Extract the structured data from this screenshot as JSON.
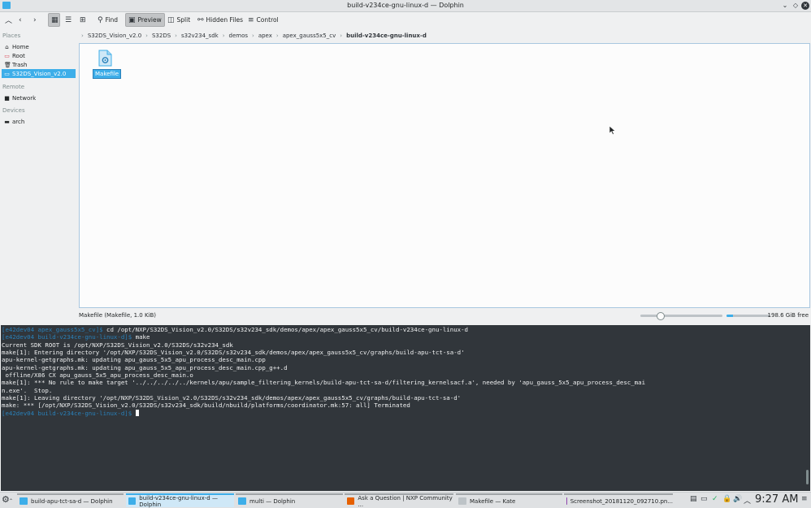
{
  "window": {
    "title": "build-v234ce-gnu-linux-d — Dolphin"
  },
  "toolbar": {
    "find": "Find",
    "preview": "Preview",
    "split": "Split",
    "hidden_files": "Hidden Files",
    "control": "Control"
  },
  "places": {
    "places_title": "Places",
    "items": [
      "Home",
      "Root",
      "Trash",
      "S32DS_Vision_v2.0"
    ],
    "remote_title": "Remote",
    "remote_items": [
      "Network"
    ],
    "devices_title": "Devices",
    "device_items": [
      "arch"
    ]
  },
  "breadcrumb": [
    "S32DS_Vision_v2.0",
    "S32DS",
    "s32v234_sdk",
    "demos",
    "apex",
    "apex_gauss5x5_cv",
    "build-v234ce-gnu-linux-d"
  ],
  "files": [
    {
      "name": "Makefile"
    }
  ],
  "statusbar": {
    "text": "Makefile (Makefile, 1.0 KiB)",
    "free": "198.6 GiB free",
    "space_used_fraction": 0.15,
    "zoom_fraction": 0.22
  },
  "terminal": {
    "lines": [
      {
        "prompt": "[e42dev04 apex_gauss5x5_cv]$",
        "text": " cd /opt/NXP/S32DS_Vision_v2.0/S32DS/s32v234_sdk/demos/apex/apex_gauss5x5_cv/build-v234ce-gnu-linux-d"
      },
      {
        "prompt": "[e42dev04 build-v234ce-gnu-linux-d]$",
        "text": " make"
      },
      {
        "prompt": "",
        "text": "Current SDK ROOT is /opt/NXP/S32DS_Vision_v2.0/S32DS/s32v234_sdk"
      },
      {
        "prompt": "",
        "text": "make[1]: Entering directory '/opt/NXP/S32DS_Vision_v2.0/S32DS/s32v234_sdk/demos/apex/apex_gauss5x5_cv/graphs/build-apu-tct-sa-d'"
      },
      {
        "prompt": "",
        "text": "apu-kernel-getgraphs.mk: updating apu_gauss_5x5_apu_process_desc_main.cpp"
      },
      {
        "prompt": "",
        "text": "apu-kernel-getgraphs.mk: updating apu_gauss_5x5_apu_process_desc_main.cpp_g++.d"
      },
      {
        "prompt": "",
        "text": " offline/X86 CX apu_gauss_5x5_apu_process_desc_main.o"
      },
      {
        "prompt": "",
        "text": "make[1]: *** No rule to make target '../../../../../kernels/apu/sample_filtering_kernels/build-apu-tct-sa-d/filtering_kernelsacf.a', needed by 'apu_gauss_5x5_apu_process_desc_mai"
      },
      {
        "prompt": "",
        "text": "n.exe'.  Stop."
      },
      {
        "prompt": "",
        "text": "make[1]: Leaving directory '/opt/NXP/S32DS_Vision_v2.0/S32DS/s32v234_sdk/demos/apex/apex_gauss5x5_cv/graphs/build-apu-tct-sa-d'"
      },
      {
        "prompt": "",
        "text": "make: *** [/opt/NXP/S32DS_Vision_v2.0/S32DS/s32v234_sdk/build/nbuild/platforms/coordinator.mk:57: all] Terminated"
      },
      {
        "prompt": "[e42dev04 build-v234ce-gnu-linux-d]$",
        "text": " "
      }
    ]
  },
  "taskbar": {
    "tasks": [
      {
        "label": "build-apu-tct-sa-d — Dolphin",
        "icon_color": "#3daee9"
      },
      {
        "label": "build-v234ce-gnu-linux-d — Dolphin",
        "icon_color": "#3daee9"
      },
      {
        "label": "multi — Dolphin",
        "icon_color": "#3daee9"
      },
      {
        "label": "Ask a Question | NXP Community ...",
        "icon_color": "#e66000"
      },
      {
        "label": "Makefile — Kate",
        "icon_color": "#bdc3c7"
      },
      {
        "label": "Screenshot_20181120_092710.pn...",
        "icon_color": "#8e44ad"
      }
    ],
    "clock": "9:27 AM"
  }
}
